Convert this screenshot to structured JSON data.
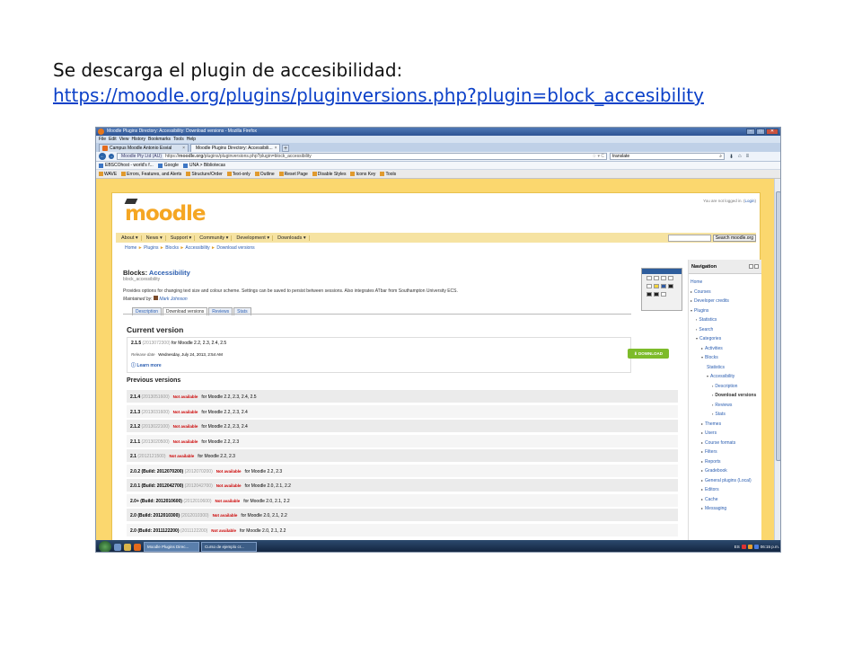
{
  "caption": {
    "line1": "Se descarga el plugin de accesibilidad:",
    "link": "https://moodle.org/plugins/pluginversions.php?plugin=block_accesibility"
  },
  "window": {
    "title": "Moodle Plugins Directory: Accessibility: Download versions - Mozilla Firefox",
    "controls": [
      "–",
      "□",
      "✕"
    ]
  },
  "menubar": [
    "File",
    "Edit",
    "View",
    "History",
    "Bookmarks",
    "Tools",
    "Help"
  ],
  "tabs": [
    {
      "label": "Campus Moodle Antonio Esvial",
      "active": false
    },
    {
      "label": "Moodle Plugins Directory: Accessibili...",
      "active": true
    }
  ],
  "navbar": {
    "site_badge": "Moodle Pty Ltd (AU)",
    "url_prefix": "https://",
    "url_domain": "moodle.org",
    "url_path": "/plugins/pluginversions.php?plugin=block_accessibility",
    "search_value": "translate",
    "back": "←",
    "forward": "→"
  },
  "bookmarks": [
    "EBSCOhost - world's f...",
    "Google",
    "UNA > Bibliotecas"
  ],
  "wave_toolbar": [
    "WAVE",
    "Errors, Features, and Alerts",
    "Structure/Order",
    "Text-only",
    "Outline",
    "Reset Page",
    "Disable Styles",
    "Icons Key",
    "Tools"
  ],
  "page": {
    "logged_in_text": "You are not logged in. (",
    "login_link": "Login",
    "logged_in_end": ")",
    "logo": "moodle",
    "main_nav": [
      "About",
      "News",
      "Support",
      "Community",
      "Development",
      "Downloads"
    ],
    "search_button": "Search moodle.org",
    "breadcrumbs": [
      "Home",
      "Plugins",
      "Blocks",
      "Accessibility",
      "Download versions"
    ],
    "block_type": "Blocks",
    "block_name": "Accessibility",
    "block_sub": "block_accessibility",
    "description": "Provides options for changing text size and colour scheme. Settings can be saved to persist between sessions. Also integrates ATbar from Southampton University ECS.",
    "maintained_label": "Maintained by:",
    "maintainer": "Mark Johnson",
    "plugin_tabs": [
      {
        "label": "Description",
        "active": false
      },
      {
        "label": "Download versions",
        "active": true
      },
      {
        "label": "Reviews",
        "active": false
      },
      {
        "label": "Stats",
        "active": false
      }
    ],
    "current_heading": "Current version",
    "current": {
      "version": "2.1.5",
      "build": "(2013072300)",
      "moodle": "for Moodle 2.2, 2.3, 2.4, 2.5",
      "release_label": "Release date",
      "release_date": "Wednesday, July 24, 2013, 2:54 AM",
      "learn_more": "Learn more",
      "download": "DOWNLOAD"
    },
    "previous_heading": "Previous versions",
    "not_available": "Not available",
    "previous": [
      {
        "version": "2.1.4",
        "build": "(2013051600)",
        "moodle": "for Moodle 2.2, 2.3, 2.4, 2.5"
      },
      {
        "version": "2.1.3",
        "build": "(2013031600)",
        "moodle": "for Moodle 2.2, 2.3, 2.4"
      },
      {
        "version": "2.1.2",
        "build": "(2013022100)",
        "moodle": "for Moodle 2.2, 2.3, 2.4"
      },
      {
        "version": "2.1.1",
        "build": "(2013020500)",
        "moodle": "for Moodle 2.2, 2.3"
      },
      {
        "version": "2.1",
        "build": "(2012121500)",
        "moodle": "for Moodle 2.2, 2.3"
      },
      {
        "version": "2.0.2 (Build: 2012070200)",
        "build": "(2012070200)",
        "moodle": "for Moodle 2.2, 2.3"
      },
      {
        "version": "2.0.1 (Build: 2012042700)",
        "build": "(2012042700)",
        "moodle": "for Moodle 2.0, 2.1, 2.2"
      },
      {
        "version": "2.0+ (Build: 2012010600)",
        "build": "(2012010600)",
        "moodle": "for Moodle 2.0, 2.1, 2.2"
      },
      {
        "version": "2.0 (Build: 2012010300)",
        "build": "(2012010300)",
        "moodle": "for Moodle 2.0, 2.1, 2.2"
      },
      {
        "version": "2.0 (Build: 2011122200)",
        "build": "(2011122200)",
        "moodle": "for Moodle 2.0, 2.1, 2.2"
      }
    ],
    "navigation": {
      "heading": "Navigation",
      "items": [
        {
          "label": "Home",
          "indent": 0,
          "toggle": ""
        },
        {
          "label": "Courses",
          "indent": 0,
          "toggle": "▸"
        },
        {
          "label": "Developer credits",
          "indent": 0,
          "toggle": "▸"
        },
        {
          "label": "Plugins",
          "indent": 0,
          "toggle": "▾"
        },
        {
          "label": "Statistics",
          "indent": 1,
          "toggle": "▪"
        },
        {
          "label": "Search",
          "indent": 1,
          "toggle": "▪"
        },
        {
          "label": "Categories",
          "indent": 1,
          "toggle": "▾"
        },
        {
          "label": "Activities",
          "indent": 2,
          "toggle": "▸"
        },
        {
          "label": "Blocks",
          "indent": 2,
          "toggle": "▾"
        },
        {
          "label": "Statistics",
          "indent": 3,
          "toggle": ""
        },
        {
          "label": "Accessibility",
          "indent": 3,
          "toggle": "▾"
        },
        {
          "label": "Description",
          "indent": 4,
          "toggle": "▪"
        },
        {
          "label": "Download versions",
          "indent": 4,
          "toggle": "▪",
          "current": true
        },
        {
          "label": "Reviews",
          "indent": 4,
          "toggle": "▪"
        },
        {
          "label": "Stats",
          "indent": 4,
          "toggle": "▪"
        },
        {
          "label": "Themes",
          "indent": 2,
          "toggle": "▸"
        },
        {
          "label": "Users",
          "indent": 2,
          "toggle": "▸"
        },
        {
          "label": "Course formats",
          "indent": 2,
          "toggle": "▸"
        },
        {
          "label": "Filters",
          "indent": 2,
          "toggle": "▸"
        },
        {
          "label": "Reports",
          "indent": 2,
          "toggle": "▸"
        },
        {
          "label": "Gradebook",
          "indent": 2,
          "toggle": "▸"
        },
        {
          "label": "General plugins (Local)",
          "indent": 2,
          "toggle": "▸"
        },
        {
          "label": "Editors",
          "indent": 2,
          "toggle": "▸"
        },
        {
          "label": "Cache",
          "indent": 2,
          "toggle": "▸"
        },
        {
          "label": "Messaging",
          "indent": 2,
          "toggle": "▸"
        }
      ]
    }
  },
  "taskbar": {
    "tasks": [
      {
        "label": "Moodle Plugins Direc...",
        "active": true
      },
      {
        "label": "Curso de ejemplo cr...",
        "active": false
      }
    ],
    "lang": "ES",
    "clock": "06:15 p.m."
  },
  "colors": {
    "moodle_orange": "#f5a623",
    "link": "#2a5db0",
    "download_green": "#7dbb2a",
    "not_available": "#cc0000",
    "page_bg": "#fbd76e"
  }
}
